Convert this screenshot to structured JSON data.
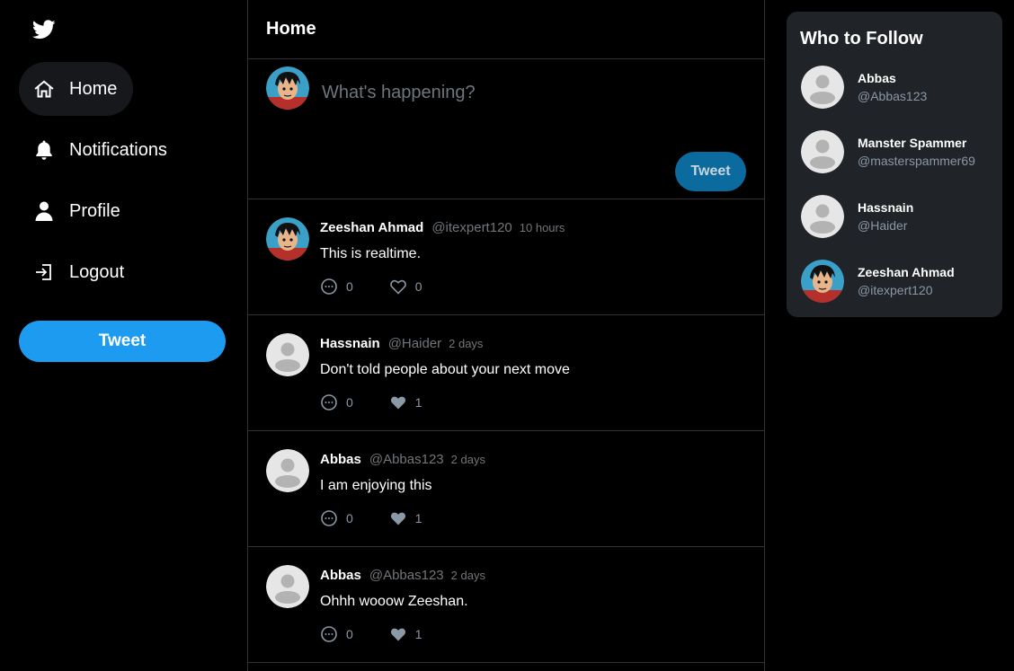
{
  "colors": {
    "background": "#000000",
    "accent": "#1d9bf0",
    "panel": "#202327",
    "border": "#2f3336",
    "muted": "#71767b"
  },
  "sidebar": {
    "logo_icon": "twitter-bird-icon",
    "items": [
      {
        "label": "Home",
        "icon": "home-icon",
        "active": true
      },
      {
        "label": "Notifications",
        "icon": "bell-icon",
        "active": false
      },
      {
        "label": "Profile",
        "icon": "user-icon",
        "active": false
      },
      {
        "label": "Logout",
        "icon": "logout-icon",
        "active": false
      }
    ],
    "tweet_button": "Tweet"
  },
  "main": {
    "title": "Home",
    "composer": {
      "placeholder": "What's happening?",
      "button": "Tweet"
    },
    "tweets": [
      {
        "name": "Zeeshan Ahmad",
        "handle": "@itexpert120",
        "time": "10 hours",
        "text": "This is realtime.",
        "replies": "0",
        "likes": "0",
        "liked": false,
        "avatar": "anime-avatar"
      },
      {
        "name": "Hassnain",
        "handle": "@Haider",
        "time": "2 days",
        "text": "Don't told people about your next move",
        "replies": "0",
        "likes": "1",
        "liked": true,
        "avatar": "default-avatar"
      },
      {
        "name": "Abbas",
        "handle": "@Abbas123",
        "time": "2 days",
        "text": "I am enjoying this",
        "replies": "0",
        "likes": "1",
        "liked": true,
        "avatar": "default-avatar"
      },
      {
        "name": "Abbas",
        "handle": "@Abbas123",
        "time": "2 days",
        "text": "Ohhh wooow Zeeshan.",
        "replies": "0",
        "likes": "1",
        "liked": true,
        "avatar": "default-avatar"
      }
    ]
  },
  "who_to_follow": {
    "title": "Who to Follow",
    "users": [
      {
        "name": "Abbas",
        "handle": "@Abbas123",
        "avatar": "default-avatar"
      },
      {
        "name": "Manster Spammer",
        "handle": "@masterspammer69",
        "avatar": "default-avatar"
      },
      {
        "name": "Hassnain",
        "handle": "@Haider",
        "avatar": "default-avatar"
      },
      {
        "name": "Zeeshan Ahmad",
        "handle": "@itexpert120",
        "avatar": "anime-avatar"
      }
    ]
  }
}
